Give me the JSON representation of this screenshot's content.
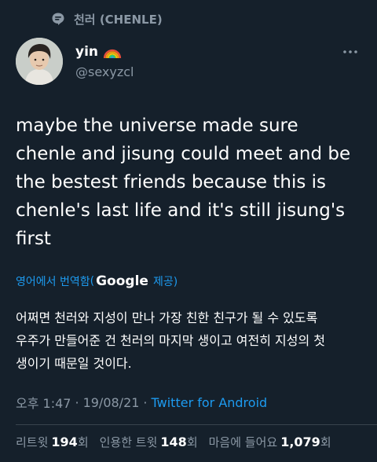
{
  "topic": {
    "label": "천러 (CHENLE)",
    "icon": "topic-icon"
  },
  "author": {
    "name": "yin",
    "name_emoji": "rainbow-icon",
    "handle": "@sexyzcl",
    "avatar": "avatar"
  },
  "tweet": {
    "lines": [
      "maybe the universe made sure",
      "chenle and jisung could meet and be",
      "the bestest friends because this is",
      "chenle's last life and it's still jisung's",
      "first"
    ]
  },
  "translate": {
    "prefix": "영어에서 번역함",
    "brand": "Google",
    "suffix": "제공)"
  },
  "translation": {
    "lines": [
      "어쩌면 천러와 지성이 만나 가장 친한 친구가 될 수 있도록",
      "우주가 만들어준 건 천러의 마지막 생이고 여전히 지성의 첫",
      "생이기 때문일 것이다."
    ]
  },
  "meta": {
    "time": "오후 1:47",
    "sep1": "·",
    "date": "19/08/21",
    "sep2": "·",
    "source": "Twitter for Android"
  },
  "stats": {
    "retweets_label": "리트윗",
    "retweets_count": "194",
    "retweets_unit": "회",
    "quotes_label": "인용한 트윗",
    "quotes_count": "148",
    "quotes_unit": "회",
    "likes_label": "마음에 들어요",
    "likes_count": "1,079",
    "likes_unit": "회"
  },
  "colors": {
    "background": "#15202b",
    "accent": "#1d9bf0",
    "secondary_text": "#8b98a5",
    "divider": "#38444d"
  }
}
